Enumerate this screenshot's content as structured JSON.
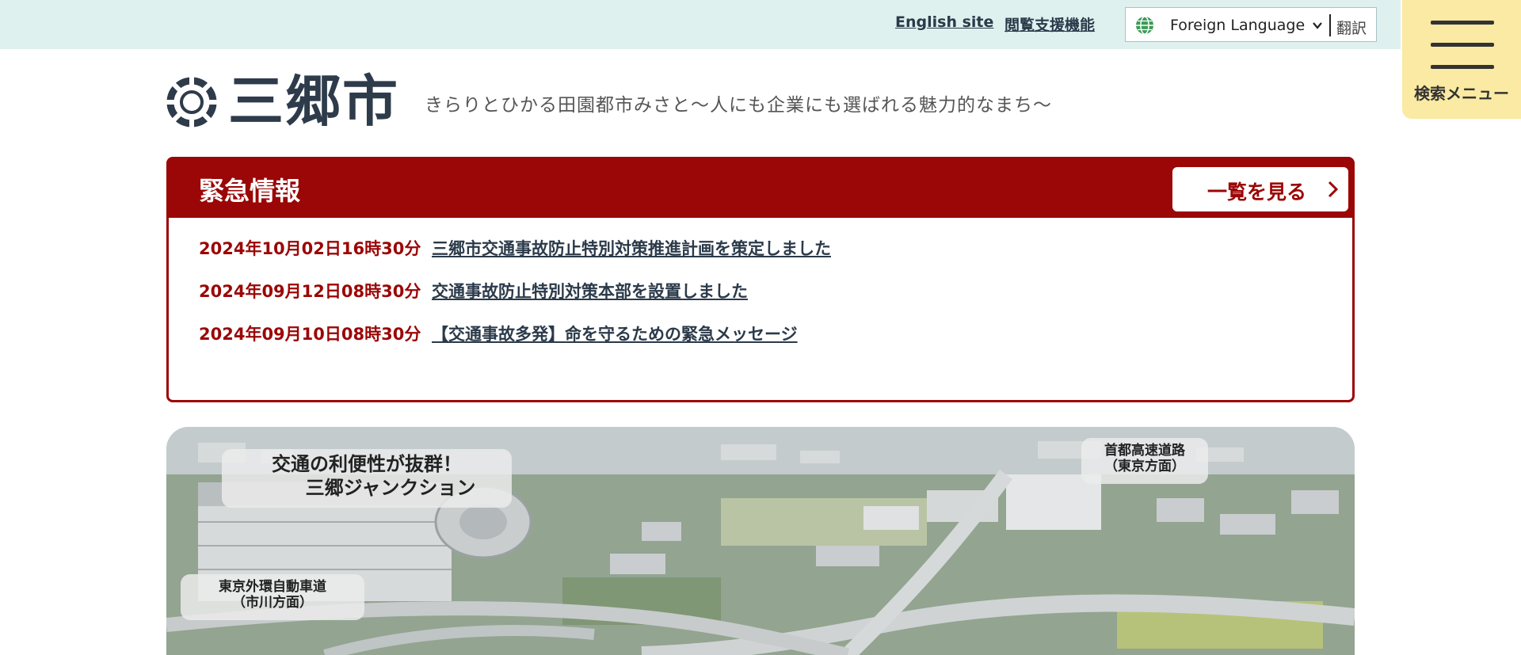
{
  "topbar": {
    "english_site": "English site",
    "accessibility": "閲覧支援機能",
    "language_select": "Foreign Language",
    "translate": "翻訳"
  },
  "menu": {
    "label": "検索メニュー"
  },
  "header": {
    "logo_text": "三郷市",
    "tagline": "きらりとひかる田園都市みさと～人にも企業にも選ばれる魅力的なまち～"
  },
  "alert": {
    "title": "緊急情報",
    "more_label": "一覧を見る",
    "items": [
      {
        "date": "2024年10月02日16時30分",
        "text": "三郷市交通事故防止特別対策推進計画を策定しました"
      },
      {
        "date": "2024年09月12日08時30分",
        "text": "交通事故防止特別対策本部を設置しました"
      },
      {
        "date": "2024年09月10日08時30分",
        "text": "【交通事故多発】命を守るための緊急メッセージ"
      }
    ]
  },
  "hero": {
    "headline_1": "交通の利便性が抜群！",
    "headline_2": "三郷ジャンクション",
    "label_right_1": "首都高速道路",
    "label_right_2": "（東京方面）",
    "label_left_1": "東京外環自動車道",
    "label_left_2": "（市川方面）"
  },
  "colors": {
    "topbar_bg": "#dff1ef",
    "menu_bg": "#faeaa3",
    "alert_red": "#9b0606",
    "link_dark": "#2b3a4a"
  },
  "icons": [
    "globe-icon",
    "chevron-down-icon",
    "hamburger-icon",
    "city-emblem-icon",
    "chevron-right-icon"
  ]
}
